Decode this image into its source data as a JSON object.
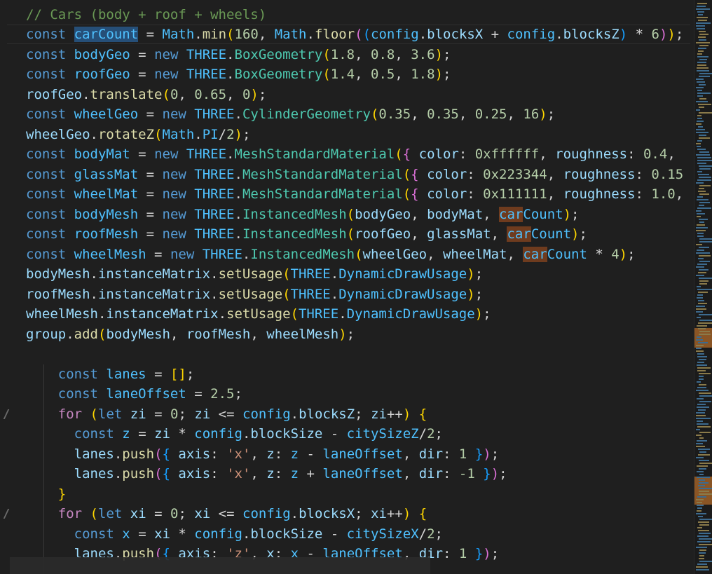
{
  "editor": {
    "lines": [
      "// Cars (body + roof + wheels)",
      "const carCount = Math.min(160, Math.floor((config.blocksX + config.blocksZ) * 6));",
      "const bodyGeo = new THREE.BoxGeometry(1.8, 0.8, 3.6);",
      "const roofGeo = new THREE.BoxGeometry(1.4, 0.5, 1.8);",
      "roofGeo.translate(0, 0.65, 0);",
      "const wheelGeo = new THREE.CylinderGeometry(0.35, 0.35, 0.25, 16);",
      "wheelGeo.rotateZ(Math.PI/2);",
      "const bodyMat = new THREE.MeshStandardMaterial({ color: 0xffffff, roughness: 0.4,",
      "const glassMat = new THREE.MeshStandardMaterial({ color: 0x223344, roughness: 0.15",
      "const wheelMat = new THREE.MeshStandardMaterial({ color: 0x111111, roughness: 1.0,",
      "const bodyMesh = new THREE.InstancedMesh(bodyGeo, bodyMat, carCount);",
      "const roofMesh = new THREE.InstancedMesh(roofGeo, glassMat, carCount);",
      "const wheelMesh = new THREE.InstancedMesh(wheelGeo, wheelMat, carCount * 4);",
      "bodyMesh.instanceMatrix.setUsage(THREE.DynamicDrawUsage);",
      "roofMesh.instanceMatrix.setUsage(THREE.DynamicDrawUsage);",
      "wheelMesh.instanceMatrix.setUsage(THREE.DynamicDrawUsage);",
      "group.add(bodyMesh, roofMesh, wheelMesh);",
      "",
      "    const lanes = [];",
      "    const laneOffset = 2.5;",
      "    for (let zi = 0; zi <= config.blocksZ; zi++) {",
      "      const z = zi * config.blockSize - citySizeZ/2;",
      "      lanes.push({ axis: 'x', z: z - laneOffset, dir: 1 });",
      "      lanes.push({ axis: 'x', z: z + laneOffset, dir: -1 });",
      "    }",
      "    for (let xi = 0; xi <= config.blocksX; xi++) {",
      "      const x = xi * config.blockSize - citySizeX/2;",
      "      lanes.push({ axis: 'z', x: x - laneOffset, dir: 1 });"
    ]
  }
}
